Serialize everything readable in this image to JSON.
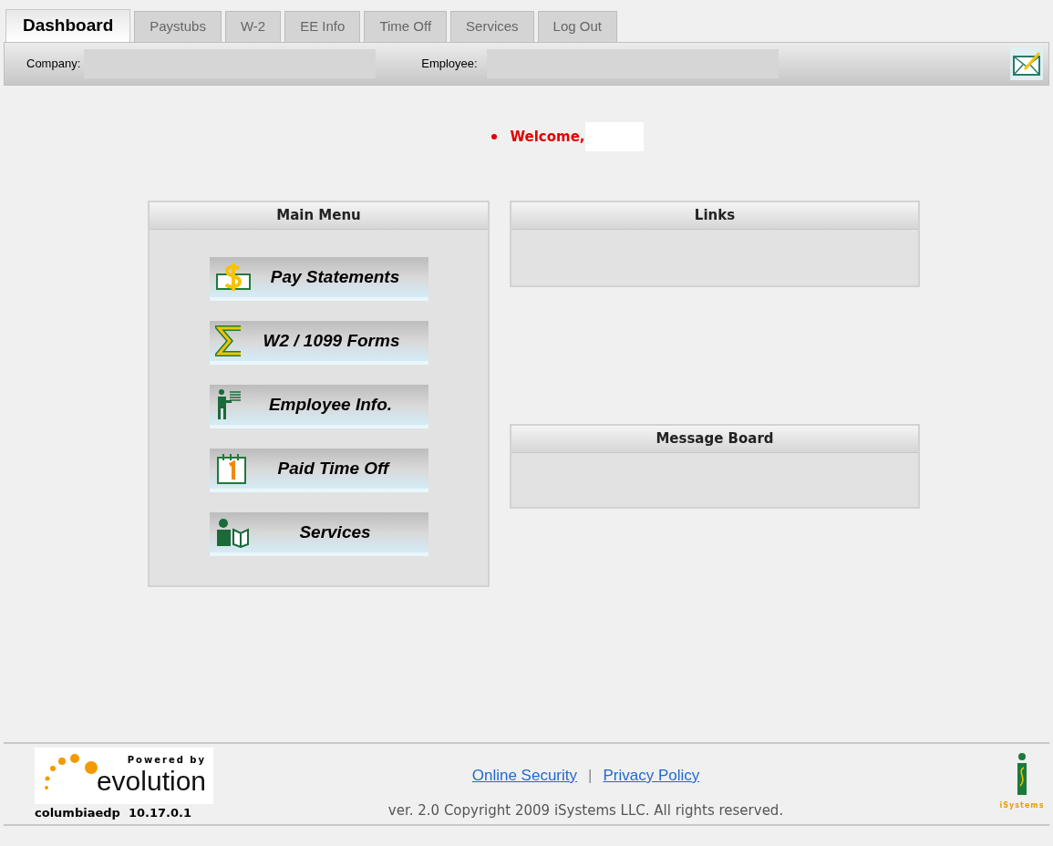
{
  "tabs": [
    {
      "label": "Dashboard",
      "selected": true
    },
    {
      "label": "Paystubs",
      "selected": false
    },
    {
      "label": "W-2",
      "selected": false
    },
    {
      "label": "EE Info",
      "selected": false
    },
    {
      "label": "Time Off",
      "selected": false
    },
    {
      "label": "Services",
      "selected": false
    },
    {
      "label": "Log Out",
      "selected": false
    }
  ],
  "info_bar": {
    "company_label": "Company:",
    "employee_label": "Employee:"
  },
  "welcome": "Welcome,",
  "main_menu": {
    "title": "Main Menu",
    "items": [
      {
        "kind": "money",
        "label": "Pay Statements"
      },
      {
        "kind": "sigma",
        "label": "W2 / 1099 Forms"
      },
      {
        "kind": "person",
        "label": "Employee Info."
      },
      {
        "kind": "calendar",
        "label": "Paid Time Off"
      },
      {
        "kind": "services",
        "label": "Services"
      }
    ]
  },
  "links": {
    "title": "Links"
  },
  "message_board": {
    "title": "Message Board"
  },
  "footer": {
    "logo_tagline": "Powered by",
    "logo_name": "evolution",
    "site_version": "columbiaedp  10.17.0.1",
    "links": [
      "Online Security",
      "Privacy Policy"
    ],
    "separator": "|",
    "copyright": "ver. 2.0 Copyright 2009 iSystems LLC. All rights reserved.",
    "brand": "iSystems"
  }
}
